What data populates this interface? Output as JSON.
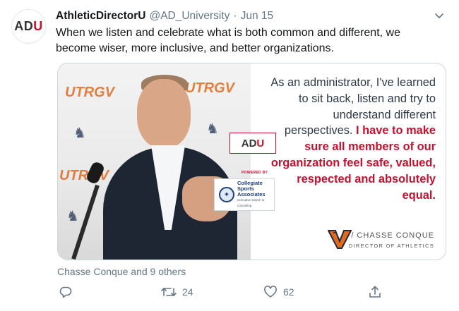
{
  "tweet": {
    "avatar_text_a": "AD",
    "avatar_text_b": "U",
    "display_name": "AthleticDirectorU",
    "handle": "@AD_University",
    "separator": "·",
    "date": "Jun 15",
    "text": "When we listen and celebrate what is both common and different, we become wiser, more inclusive, and better organizations."
  },
  "card": {
    "watermark": "UTRGV",
    "adu_badge_a": "AD",
    "adu_badge_b": "U",
    "powered_by": "POWERED BY",
    "csa_line1": "Collegiate",
    "csa_line2": "Sports Associates",
    "csa_line3": "executive search & consulting",
    "quote_plain": "As an administrator, I've learned to sit back, listen and try to understand different perspectives. ",
    "quote_highlight": "I have to make sure all members of our organization feel safe, valued, respected and absolutely equal.",
    "attribution_name": "/ CHASSE CONQUE",
    "attribution_title": "DIRECTOR OF ATHLETICS"
  },
  "engagement": {
    "likers": "Chasse Conque and 9 others",
    "reply_count": "",
    "retweet_count": "24",
    "like_count": "62"
  },
  "colors": {
    "brand_red": "#c8102e",
    "muted_text": "#657786",
    "utrgv_orange": "#e06b1f"
  },
  "icons": {
    "reply": "reply-icon",
    "retweet": "retweet-icon",
    "like": "heart-icon",
    "share": "share-icon",
    "more": "chevron-down-icon"
  }
}
